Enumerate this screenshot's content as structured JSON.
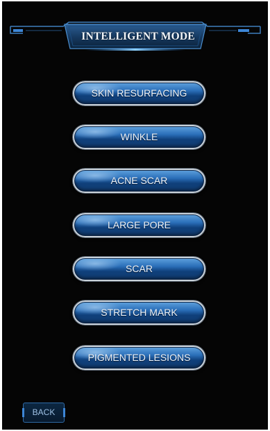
{
  "header": {
    "title": "INTELLIGENT MODE"
  },
  "modes": [
    {
      "label": "SKIN RESURFACING"
    },
    {
      "label": "WINKLE"
    },
    {
      "label": "ACNE SCAR"
    },
    {
      "label": "LARGE PORE"
    },
    {
      "label": "SCAR"
    },
    {
      "label": "STRETCH MARK"
    },
    {
      "label": "PIGMENTED LESIONS"
    }
  ],
  "footer": {
    "back_label": "BACK"
  },
  "colors": {
    "background": "#050505",
    "accent": "#3d86d6",
    "button_blue": "#2a6eb8"
  }
}
